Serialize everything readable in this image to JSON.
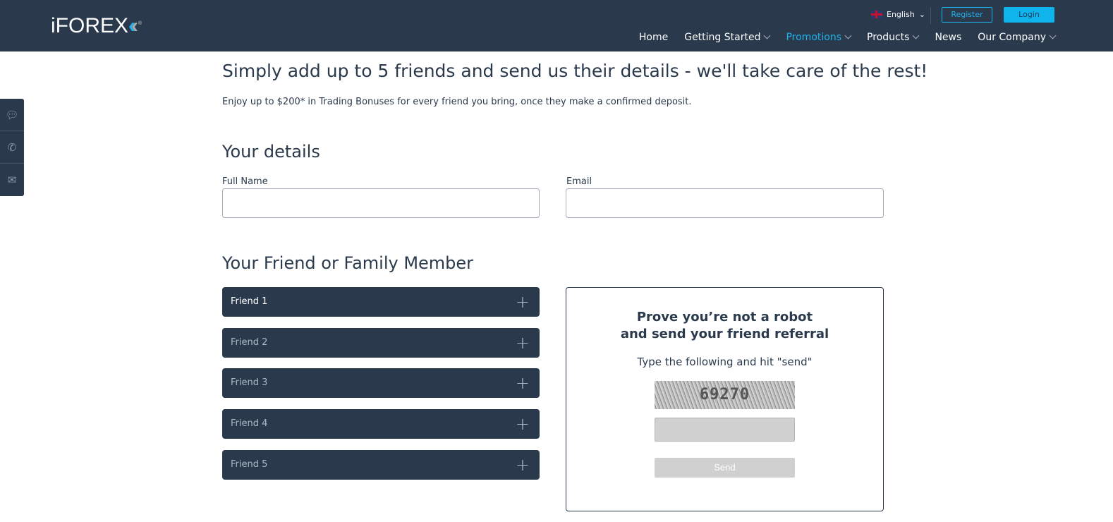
{
  "header": {
    "logo": "iFOREX",
    "language": "English",
    "register": "Register",
    "login": "Login",
    "nav": [
      {
        "label": "Home"
      },
      {
        "label": "Getting Started"
      },
      {
        "label": "Promotions"
      },
      {
        "label": "Products"
      },
      {
        "label": "News"
      },
      {
        "label": "Our Company"
      }
    ]
  },
  "side_icons": [
    "chat-icon",
    "phone-icon",
    "mail-icon"
  ],
  "main": {
    "title": "Simply add up to 5 friends and send us their details - we'll take care of the rest!",
    "subtitle": "Enjoy up to $200* in Trading Bonuses for every friend you bring, once they make a confirmed deposit.",
    "details_heading": "Your details",
    "full_name_label": "Full Name",
    "email_label": "Email",
    "friends_heading": "Your Friend or Family Member",
    "friends": [
      "Friend 1",
      "Friend 2",
      "Friend 3",
      "Friend 4",
      "Friend 5"
    ]
  },
  "captcha": {
    "title_line1": "Prove you’re not a robot",
    "title_line2": "and send your friend referral",
    "instruction": "Type the following and hit \"send\"",
    "code": "69270",
    "send": "Send"
  }
}
